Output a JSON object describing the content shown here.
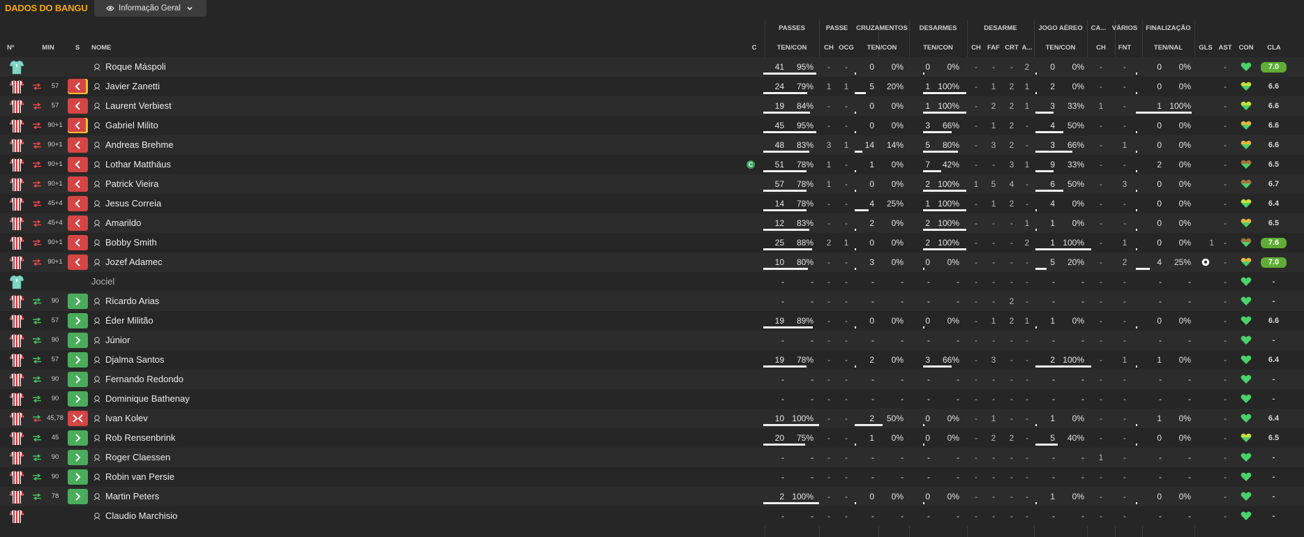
{
  "header": {
    "title": "DADOS DO BANGU",
    "view_selector": "Informação Geral",
    "icons": {
      "view": "eye-icon",
      "dropdown": "chevron-down-icon"
    }
  },
  "groups": {
    "passes": "PASSES",
    "passe": "PASSE",
    "cruzamentos": "CRUZAMENTOS",
    "desarmes": "DESARMES",
    "desarme": "DESARME",
    "jogo_aereo": "JOGO AÉREO",
    "ca": "CA...",
    "varios": "VÁRIOS",
    "finalizacao": "FINALIZAÇÃO"
  },
  "columns": {
    "no": "Nº",
    "min": "MIN",
    "s": "S",
    "nome": "NOME",
    "c": "C",
    "passes": "TEN/CON",
    "passe_ch": "CH",
    "passe_ocg": "OCG",
    "cruz": "TEN/CON",
    "desarmes": "TEN/CON",
    "des_ch": "CH",
    "des_faf": "FAF",
    "des_crt": "CRT",
    "des_a": "A...",
    "aereo": "TEN/CON",
    "ca_ch": "CH",
    "fnt": "FNT",
    "final": "TEN/NAL",
    "gls": "GLS",
    "ast": "AST",
    "con": "CON",
    "cla": "CLA"
  },
  "colors": {
    "accent": "#f5a800",
    "sub_out": "#d64545",
    "sub_in": "#4aad5b",
    "rating_high": "#5fad36",
    "yellow_card": "#f2c029"
  },
  "rows": [
    {
      "kit": "gk",
      "subdir": "",
      "min": "",
      "sub": "",
      "yc": false,
      "name": "Roque Máspoli",
      "person": true,
      "captain": false,
      "p_t": "41",
      "p_p": "95%",
      "p_b": 0.95,
      "ch1": "-",
      "ocg": "-",
      "cr_t": "0",
      "cr_p": "0%",
      "cr_b": 0,
      "de_t": "0",
      "de_p": "0%",
      "de_b": 0,
      "dch": "-",
      "faf": "-",
      "crt": "-",
      "a": "2",
      "ae_t": "0",
      "ae_p": "0%",
      "ae_b": 0,
      "cach": "-",
      "fnt": "-",
      "fi_t": "0",
      "fi_p": "0%",
      "fi_b": 0,
      "ball": false,
      "gls": "",
      "ast": "-",
      "heart": "green",
      "cla": "7.0",
      "cla_hi": true
    },
    {
      "kit": "out",
      "subdir": "off",
      "min": "57",
      "sub": "out",
      "yc": true,
      "name": "Javier Zanetti",
      "person": true,
      "captain": false,
      "p_t": "24",
      "p_p": "79%",
      "p_b": 0.79,
      "ch1": "1",
      "ocg": "1",
      "cr_t": "5",
      "cr_p": "20%",
      "cr_b": 0.2,
      "de_t": "1",
      "de_p": "100%",
      "de_b": 1,
      "dch": "-",
      "faf": "1",
      "crt": "2",
      "a": "1",
      "ae_t": "2",
      "ae_p": "0%",
      "ae_b": 0,
      "cach": "-",
      "fnt": "-",
      "fi_t": "0",
      "fi_p": "0%",
      "fi_b": 0,
      "ball": false,
      "gls": "",
      "ast": "-",
      "heart": "lime",
      "cla": "6.6",
      "cla_hi": false
    },
    {
      "kit": "out",
      "subdir": "off",
      "min": "57",
      "sub": "out",
      "yc": false,
      "name": "Laurent Verbiest",
      "person": true,
      "captain": false,
      "p_t": "19",
      "p_p": "84%",
      "p_b": 0.84,
      "ch1": "-",
      "ocg": "-",
      "cr_t": "0",
      "cr_p": "0%",
      "cr_b": 0,
      "de_t": "1",
      "de_p": "100%",
      "de_b": 1,
      "dch": "-",
      "faf": "2",
      "crt": "2",
      "a": "1",
      "ae_t": "3",
      "ae_p": "33%",
      "ae_b": 0.33,
      "cach": "1",
      "fnt": "-",
      "fi_t": "1",
      "fi_p": "100%",
      "fi_b": 1,
      "ball": false,
      "gls": "",
      "ast": "-",
      "heart": "lime",
      "cla": "6.6",
      "cla_hi": false
    },
    {
      "kit": "out",
      "subdir": "off",
      "min": "90+1",
      "sub": "out",
      "yc": true,
      "name": "Gabriel Milito",
      "person": true,
      "captain": false,
      "p_t": "45",
      "p_p": "95%",
      "p_b": 0.95,
      "ch1": "-",
      "ocg": "-",
      "cr_t": "0",
      "cr_p": "0%",
      "cr_b": 0,
      "de_t": "3",
      "de_p": "66%",
      "de_b": 0.66,
      "dch": "-",
      "faf": "1",
      "crt": "2",
      "a": "-",
      "ae_t": "4",
      "ae_p": "50%",
      "ae_b": 0.5,
      "cach": "-",
      "fnt": "-",
      "fi_t": "0",
      "fi_p": "0%",
      "fi_b": 0,
      "ball": false,
      "gls": "",
      "ast": "-",
      "heart": "yellow",
      "cla": "6.6",
      "cla_hi": false
    },
    {
      "kit": "out",
      "subdir": "off",
      "min": "90+1",
      "sub": "out",
      "yc": false,
      "name": "Andreas Brehme",
      "person": true,
      "captain": false,
      "p_t": "48",
      "p_p": "83%",
      "p_b": 0.83,
      "ch1": "3",
      "ocg": "1",
      "cr_t": "14",
      "cr_p": "14%",
      "cr_b": 0.14,
      "de_t": "5",
      "de_p": "80%",
      "de_b": 0.8,
      "dch": "-",
      "faf": "3",
      "crt": "2",
      "a": "-",
      "ae_t": "3",
      "ae_p": "66%",
      "ae_b": 0.66,
      "cach": "-",
      "fnt": "1",
      "fi_t": "0",
      "fi_p": "0%",
      "fi_b": 0,
      "ball": false,
      "gls": "",
      "ast": "-",
      "heart": "yellow",
      "cla": "6.6",
      "cla_hi": false
    },
    {
      "kit": "out",
      "subdir": "off",
      "min": "90+1",
      "sub": "out",
      "yc": false,
      "name": "Lothar Matthäus",
      "person": true,
      "captain": true,
      "p_t": "51",
      "p_p": "78%",
      "p_b": 0.78,
      "ch1": "1",
      "ocg": "-",
      "cr_t": "1",
      "cr_p": "0%",
      "cr_b": 0,
      "de_t": "7",
      "de_p": "42%",
      "de_b": 0.42,
      "dch": "-",
      "faf": "-",
      "crt": "3",
      "a": "1",
      "ae_t": "9",
      "ae_p": "33%",
      "ae_b": 0.33,
      "cach": "-",
      "fnt": "-",
      "fi_t": "2",
      "fi_p": "0%",
      "fi_b": 0,
      "ball": false,
      "gls": "",
      "ast": "-",
      "heart": "brown",
      "cla": "6.5",
      "cla_hi": false
    },
    {
      "kit": "out",
      "subdir": "off",
      "min": "90+1",
      "sub": "out",
      "yc": false,
      "name": "Patrick Vieira",
      "person": true,
      "captain": false,
      "p_t": "57",
      "p_p": "78%",
      "p_b": 0.78,
      "ch1": "1",
      "ocg": "-",
      "cr_t": "0",
      "cr_p": "0%",
      "cr_b": 0,
      "de_t": "2",
      "de_p": "100%",
      "de_b": 1,
      "dch": "1",
      "faf": "5",
      "crt": "4",
      "a": "-",
      "ae_t": "6",
      "ae_p": "50%",
      "ae_b": 0.5,
      "cach": "-",
      "fnt": "3",
      "fi_t": "0",
      "fi_p": "0%",
      "fi_b": 0,
      "ball": false,
      "gls": "",
      "ast": "-",
      "heart": "brown",
      "cla": "6.7",
      "cla_hi": false
    },
    {
      "kit": "out",
      "subdir": "off",
      "min": "45+4",
      "sub": "out",
      "yc": false,
      "name": "Jesus Correia",
      "person": true,
      "captain": false,
      "p_t": "14",
      "p_p": "78%",
      "p_b": 0.78,
      "ch1": "-",
      "ocg": "-",
      "cr_t": "4",
      "cr_p": "25%",
      "cr_b": 0.25,
      "de_t": "1",
      "de_p": "100%",
      "de_b": 1,
      "dch": "-",
      "faf": "1",
      "crt": "2",
      "a": "-",
      "ae_t": "4",
      "ae_p": "0%",
      "ae_b": 0,
      "cach": "-",
      "fnt": "-",
      "fi_t": "0",
      "fi_p": "0%",
      "fi_b": 0,
      "ball": false,
      "gls": "",
      "ast": "-",
      "heart": "lime",
      "cla": "6.4",
      "cla_hi": false
    },
    {
      "kit": "out",
      "subdir": "off",
      "min": "45+4",
      "sub": "out",
      "yc": false,
      "name": "Amarildo",
      "person": true,
      "captain": false,
      "p_t": "12",
      "p_p": "83%",
      "p_b": 0.83,
      "ch1": "-",
      "ocg": "-",
      "cr_t": "2",
      "cr_p": "0%",
      "cr_b": 0,
      "de_t": "2",
      "de_p": "100%",
      "de_b": 1,
      "dch": "-",
      "faf": "-",
      "crt": "-",
      "a": "1",
      "ae_t": "1",
      "ae_p": "0%",
      "ae_b": 0,
      "cach": "-",
      "fnt": "-",
      "fi_t": "0",
      "fi_p": "0%",
      "fi_b": 0,
      "ball": false,
      "gls": "",
      "ast": "-",
      "heart": "yellow",
      "cla": "6.5",
      "cla_hi": false
    },
    {
      "kit": "out",
      "subdir": "off",
      "min": "90+1",
      "sub": "out",
      "yc": false,
      "name": "Bobby Smith",
      "person": true,
      "captain": false,
      "p_t": "25",
      "p_p": "88%",
      "p_b": 0.88,
      "ch1": "2",
      "ocg": "1",
      "cr_t": "0",
      "cr_p": "0%",
      "cr_b": 0,
      "de_t": "2",
      "de_p": "100%",
      "de_b": 1,
      "dch": "-",
      "faf": "-",
      "crt": "-",
      "a": "2",
      "ae_t": "1",
      "ae_p": "100%",
      "ae_b": 1,
      "cach": "-",
      "fnt": "1",
      "fi_t": "0",
      "fi_p": "0%",
      "fi_b": 0,
      "ball": false,
      "gls": "1",
      "ast": "-",
      "heart": "brown",
      "cla": "7.6",
      "cla_hi": true
    },
    {
      "kit": "out",
      "subdir": "off",
      "min": "90+1",
      "sub": "out",
      "yc": false,
      "name": "Jozef Adamec",
      "person": true,
      "captain": false,
      "p_t": "10",
      "p_p": "80%",
      "p_b": 0.8,
      "ch1": "-",
      "ocg": "-",
      "cr_t": "3",
      "cr_p": "0%",
      "cr_b": 0,
      "de_t": "0",
      "de_p": "0%",
      "de_b": 0,
      "dch": "-",
      "faf": "-",
      "crt": "-",
      "a": "-",
      "ae_t": "5",
      "ae_p": "20%",
      "ae_b": 0.2,
      "cach": "-",
      "fnt": "2",
      "fi_t": "4",
      "fi_p": "25%",
      "fi_b": 0.25,
      "ball": true,
      "gls": "",
      "ast": "-",
      "heart": "yellow",
      "cla": "7.0",
      "cla_hi": true
    },
    {
      "kit": "gk",
      "subdir": "",
      "min": "",
      "sub": "",
      "yc": false,
      "name": "Jociel",
      "person": false,
      "captain": false,
      "p_t": "-",
      "p_p": "-",
      "p_b": -1,
      "ch1": "-",
      "ocg": "-",
      "cr_t": "-",
      "cr_p": "-",
      "cr_b": -1,
      "de_t": "-",
      "de_p": "-",
      "de_b": -1,
      "dch": "-",
      "faf": "-",
      "crt": "-",
      "a": "-",
      "ae_t": "-",
      "ae_p": "-",
      "ae_b": -1,
      "cach": "-",
      "fnt": "-",
      "fi_t": "-",
      "fi_p": "-",
      "fi_b": -1,
      "ball": false,
      "gls": "",
      "ast": "-",
      "heart": "green",
      "cla": "-",
      "cla_hi": false
    },
    {
      "kit": "out",
      "subdir": "on",
      "min": "90",
      "sub": "in",
      "yc": false,
      "name": "Ricardo Arias",
      "person": true,
      "captain": false,
      "p_t": "-",
      "p_p": "-",
      "p_b": -1,
      "ch1": "-",
      "ocg": "-",
      "cr_t": "-",
      "cr_p": "-",
      "cr_b": -1,
      "de_t": "-",
      "de_p": "-",
      "de_b": -1,
      "dch": "-",
      "faf": "-",
      "crt": "2",
      "a": "-",
      "ae_t": "-",
      "ae_p": "-",
      "ae_b": -1,
      "cach": "-",
      "fnt": "-",
      "fi_t": "-",
      "fi_p": "-",
      "fi_b": -1,
      "ball": false,
      "gls": "",
      "ast": "-",
      "heart": "green",
      "cla": "-",
      "cla_hi": false
    },
    {
      "kit": "out",
      "subdir": "on",
      "min": "57",
      "sub": "in",
      "yc": false,
      "name": "Éder Militão",
      "person": true,
      "captain": false,
      "p_t": "19",
      "p_p": "89%",
      "p_b": 0.89,
      "ch1": "-",
      "ocg": "-",
      "cr_t": "0",
      "cr_p": "0%",
      "cr_b": 0,
      "de_t": "0",
      "de_p": "0%",
      "de_b": 0,
      "dch": "-",
      "faf": "1",
      "crt": "2",
      "a": "1",
      "ae_t": "1",
      "ae_p": "0%",
      "ae_b": 0,
      "cach": "-",
      "fnt": "-",
      "fi_t": "0",
      "fi_p": "0%",
      "fi_b": 0,
      "ball": false,
      "gls": "",
      "ast": "-",
      "heart": "green",
      "cla": "6.6",
      "cla_hi": false
    },
    {
      "kit": "out",
      "subdir": "on",
      "min": "90",
      "sub": "in",
      "yc": false,
      "name": "Júnior",
      "person": true,
      "captain": false,
      "p_t": "-",
      "p_p": "-",
      "p_b": -1,
      "ch1": "-",
      "ocg": "-",
      "cr_t": "-",
      "cr_p": "-",
      "cr_b": -1,
      "de_t": "-",
      "de_p": "-",
      "de_b": -1,
      "dch": "-",
      "faf": "-",
      "crt": "-",
      "a": "-",
      "ae_t": "-",
      "ae_p": "-",
      "ae_b": -1,
      "cach": "-",
      "fnt": "-",
      "fi_t": "-",
      "fi_p": "-",
      "fi_b": -1,
      "ball": false,
      "gls": "",
      "ast": "-",
      "heart": "green",
      "cla": "-",
      "cla_hi": false
    },
    {
      "kit": "out",
      "subdir": "on",
      "min": "57",
      "sub": "in",
      "yc": false,
      "name": "Djalma Santos",
      "person": true,
      "captain": false,
      "p_t": "19",
      "p_p": "78%",
      "p_b": 0.78,
      "ch1": "-",
      "ocg": "-",
      "cr_t": "2",
      "cr_p": "0%",
      "cr_b": 0,
      "de_t": "3",
      "de_p": "66%",
      "de_b": 0.66,
      "dch": "-",
      "faf": "3",
      "crt": "-",
      "a": "-",
      "ae_t": "2",
      "ae_p": "100%",
      "ae_b": 1,
      "cach": "-",
      "fnt": "1",
      "fi_t": "1",
      "fi_p": "0%",
      "fi_b": 0,
      "ball": false,
      "gls": "",
      "ast": "-",
      "heart": "green",
      "cla": "6.4",
      "cla_hi": false
    },
    {
      "kit": "out",
      "subdir": "on",
      "min": "90",
      "sub": "in",
      "yc": false,
      "name": "Fernando Redondo",
      "person": true,
      "captain": false,
      "p_t": "-",
      "p_p": "-",
      "p_b": -1,
      "ch1": "-",
      "ocg": "-",
      "cr_t": "-",
      "cr_p": "-",
      "cr_b": -1,
      "de_t": "-",
      "de_p": "-",
      "de_b": -1,
      "dch": "-",
      "faf": "-",
      "crt": "-",
      "a": "-",
      "ae_t": "-",
      "ae_p": "-",
      "ae_b": -1,
      "cach": "-",
      "fnt": "-",
      "fi_t": "-",
      "fi_p": "-",
      "fi_b": -1,
      "ball": false,
      "gls": "",
      "ast": "-",
      "heart": "green",
      "cla": "-",
      "cla_hi": false
    },
    {
      "kit": "out",
      "subdir": "on",
      "min": "90",
      "sub": "in",
      "yc": false,
      "name": "Dominique Bathenay",
      "person": true,
      "captain": false,
      "p_t": "-",
      "p_p": "-",
      "p_b": -1,
      "ch1": "-",
      "ocg": "-",
      "cr_t": "-",
      "cr_p": "-",
      "cr_b": -1,
      "de_t": "-",
      "de_p": "-",
      "de_b": -1,
      "dch": "-",
      "faf": "-",
      "crt": "-",
      "a": "-",
      "ae_t": "-",
      "ae_p": "-",
      "ae_b": -1,
      "cach": "-",
      "fnt": "-",
      "fi_t": "-",
      "fi_p": "-",
      "fi_b": -1,
      "ball": false,
      "gls": "",
      "ast": "-",
      "heart": "green",
      "cla": "-",
      "cla_hi": false
    },
    {
      "kit": "out",
      "subdir": "both",
      "min": "45,78",
      "sub": "both",
      "yc": false,
      "name": "Ivan Kolev",
      "person": true,
      "captain": false,
      "p_t": "10",
      "p_p": "100%",
      "p_b": 1,
      "ch1": "-",
      "ocg": "-",
      "cr_t": "2",
      "cr_p": "50%",
      "cr_b": 0.5,
      "de_t": "0",
      "de_p": "0%",
      "de_b": 0,
      "dch": "-",
      "faf": "1",
      "crt": "-",
      "a": "-",
      "ae_t": "1",
      "ae_p": "0%",
      "ae_b": 0,
      "cach": "-",
      "fnt": "-",
      "fi_t": "1",
      "fi_p": "0%",
      "fi_b": 0,
      "ball": false,
      "gls": "",
      "ast": "-",
      "heart": "green",
      "cla": "6.4",
      "cla_hi": false
    },
    {
      "kit": "out",
      "subdir": "on",
      "min": "45",
      "sub": "in",
      "yc": false,
      "name": "Rob Rensenbrink",
      "person": true,
      "captain": false,
      "p_t": "20",
      "p_p": "75%",
      "p_b": 0.75,
      "ch1": "-",
      "ocg": "-",
      "cr_t": "1",
      "cr_p": "0%",
      "cr_b": 0,
      "de_t": "0",
      "de_p": "0%",
      "de_b": 0,
      "dch": "-",
      "faf": "2",
      "crt": "2",
      "a": "-",
      "ae_t": "5",
      "ae_p": "40%",
      "ae_b": 0.4,
      "cach": "-",
      "fnt": "-",
      "fi_t": "0",
      "fi_p": "0%",
      "fi_b": 0,
      "ball": false,
      "gls": "",
      "ast": "-",
      "heart": "lime",
      "cla": "6.5",
      "cla_hi": false
    },
    {
      "kit": "out",
      "subdir": "on",
      "min": "90",
      "sub": "in",
      "yc": false,
      "name": "Roger Claessen",
      "person": true,
      "captain": false,
      "p_t": "-",
      "p_p": "-",
      "p_b": -1,
      "ch1": "-",
      "ocg": "-",
      "cr_t": "-",
      "cr_p": "-",
      "cr_b": -1,
      "de_t": "-",
      "de_p": "-",
      "de_b": -1,
      "dch": "-",
      "faf": "-",
      "crt": "-",
      "a": "-",
      "ae_t": "-",
      "ae_p": "-",
      "ae_b": -1,
      "cach": "1",
      "fnt": "-",
      "fi_t": "-",
      "fi_p": "-",
      "fi_b": -1,
      "ball": false,
      "gls": "",
      "ast": "-",
      "heart": "green",
      "cla": "-",
      "cla_hi": false
    },
    {
      "kit": "out",
      "subdir": "on",
      "min": "90",
      "sub": "in",
      "yc": false,
      "name": "Robin van Persie",
      "person": true,
      "captain": false,
      "p_t": "-",
      "p_p": "-",
      "p_b": -1,
      "ch1": "-",
      "ocg": "-",
      "cr_t": "-",
      "cr_p": "-",
      "cr_b": -1,
      "de_t": "-",
      "de_p": "-",
      "de_b": -1,
      "dch": "-",
      "faf": "-",
      "crt": "-",
      "a": "-",
      "ae_t": "-",
      "ae_p": "-",
      "ae_b": -1,
      "cach": "-",
      "fnt": "-",
      "fi_t": "-",
      "fi_p": "-",
      "fi_b": -1,
      "ball": false,
      "gls": "",
      "ast": "-",
      "heart": "green",
      "cla": "-",
      "cla_hi": false
    },
    {
      "kit": "out",
      "subdir": "on",
      "min": "78",
      "sub": "in",
      "yc": false,
      "name": "Martin Peters",
      "person": true,
      "captain": false,
      "p_t": "2",
      "p_p": "100%",
      "p_b": 1,
      "ch1": "-",
      "ocg": "-",
      "cr_t": "0",
      "cr_p": "0%",
      "cr_b": 0,
      "de_t": "0",
      "de_p": "0%",
      "de_b": 0,
      "dch": "-",
      "faf": "-",
      "crt": "-",
      "a": "-",
      "ae_t": "1",
      "ae_p": "0%",
      "ae_b": 0,
      "cach": "-",
      "fnt": "-",
      "fi_t": "0",
      "fi_p": "0%",
      "fi_b": 0,
      "ball": false,
      "gls": "",
      "ast": "-",
      "heart": "green",
      "cla": "-",
      "cla_hi": false
    },
    {
      "kit": "out",
      "subdir": "",
      "min": "",
      "sub": "",
      "yc": false,
      "name": "Claudio Marchisio",
      "person": true,
      "captain": false,
      "p_t": "-",
      "p_p": "-",
      "p_b": -1,
      "ch1": "-",
      "ocg": "-",
      "cr_t": "-",
      "cr_p": "-",
      "cr_b": -1,
      "de_t": "-",
      "de_p": "-",
      "de_b": -1,
      "dch": "-",
      "faf": "-",
      "crt": "-",
      "a": "-",
      "ae_t": "-",
      "ae_p": "-",
      "ae_b": -1,
      "cach": "-",
      "fnt": "-",
      "fi_t": "-",
      "fi_p": "-",
      "fi_b": -1,
      "ball": false,
      "gls": "",
      "ast": "-",
      "heart": "green",
      "cla": "-",
      "cla_hi": false
    }
  ]
}
